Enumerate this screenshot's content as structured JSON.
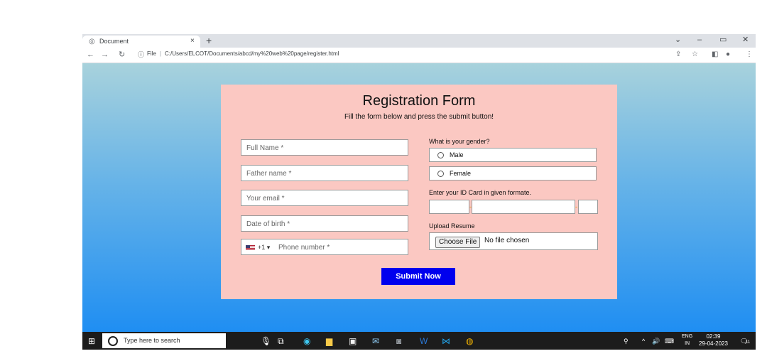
{
  "browser": {
    "tab_title": "Document",
    "tab_close": "×",
    "new_tab": "+",
    "file_label": "File",
    "separator": "|",
    "url": "C:/Users/ELCOT/Documents/abcd/my%20web%20page/register.html"
  },
  "form": {
    "title": "Registration Form",
    "subtitle": "Fill the form below and press the submit button!",
    "full_name_placeholder": "Full Name *",
    "father_name_placeholder": "Father name *",
    "email_placeholder": "Your email *",
    "dob_placeholder": "Date of birth *",
    "country_code": "+1 ▾",
    "phone_placeholder": "Phone number *",
    "gender_label": "What is your gender?",
    "gender_options": [
      "Male",
      "Female"
    ],
    "id_label": "Enter your ID Card in given formate.",
    "resume_label": "Upload Resume",
    "choose_file": "Choose File",
    "no_file": "No file chosen",
    "submit_label": "Submit Now"
  },
  "taskbar": {
    "search_placeholder": "Type here to search",
    "lang_top": "ENG",
    "lang_bottom": "IN",
    "time": "02:39",
    "date": "29-04-2023",
    "notification_count": "11"
  },
  "colors": {
    "form_bg": "#fbc8c2",
    "submit_bg": "#0000ee",
    "page_gradient_top": "#a8d2dc",
    "page_gradient_bottom": "#1f8ef2"
  }
}
